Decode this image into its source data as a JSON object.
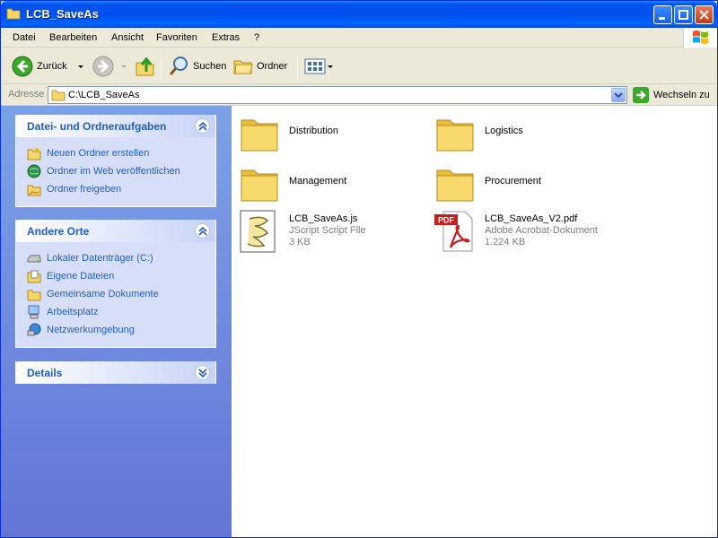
{
  "window": {
    "title": "LCB_SaveAs"
  },
  "menu": [
    {
      "label": "Datei"
    },
    {
      "label": "Bearbeiten"
    },
    {
      "label": "Ansicht"
    },
    {
      "label": "Favoriten"
    },
    {
      "label": "Extras"
    },
    {
      "label": "?"
    }
  ],
  "toolbar": {
    "back_label": "Zurück",
    "search_label": "Suchen",
    "folders_label": "Ordner"
  },
  "address": {
    "label": "Adresse",
    "value": "C:\\LCB_SaveAs",
    "go_label": "Wechseln zu"
  },
  "taskpane": {
    "file_tasks": {
      "title": "Datei- und Ordneraufgaben",
      "items": [
        {
          "label": "Neuen Ordner erstellen",
          "icon": "new-folder-icon"
        },
        {
          "label": "Ordner im Web veröffentlichen",
          "icon": "web-publish-icon"
        },
        {
          "label": "Ordner freigeben",
          "icon": "share-folder-icon"
        }
      ]
    },
    "other_places": {
      "title": "Andere Orte",
      "items": [
        {
          "label": "Lokaler Datenträger (C:)",
          "icon": "drive-icon"
        },
        {
          "label": "Eigene Dateien",
          "icon": "my-documents-icon"
        },
        {
          "label": "Gemeinsame Dokumente",
          "icon": "shared-documents-icon"
        },
        {
          "label": "Arbeitsplatz",
          "icon": "my-computer-icon"
        },
        {
          "label": "Netzwerkumgebung",
          "icon": "network-icon"
        }
      ]
    },
    "details": {
      "title": "Details"
    }
  },
  "files": [
    {
      "name": "Distribution",
      "type": "folder"
    },
    {
      "name": "Logistics",
      "type": "folder"
    },
    {
      "name": "Management",
      "type": "folder"
    },
    {
      "name": "Procurement",
      "type": "folder"
    },
    {
      "name": "LCB_SaveAs.js",
      "type": "script",
      "kind": "JScript Script File",
      "size": "3 KB"
    },
    {
      "name": "LCB_SaveAs_V2.pdf",
      "type": "pdf",
      "kind": "Adobe Acrobat-Dokument",
      "size": "1.224 KB"
    }
  ],
  "colors": {
    "titlebar": "#0053ee",
    "taskpane_top": "#7ba2e7",
    "taskpane_bottom": "#6375d6",
    "task_link": "#215dc6",
    "folder": "#f5d66b"
  }
}
